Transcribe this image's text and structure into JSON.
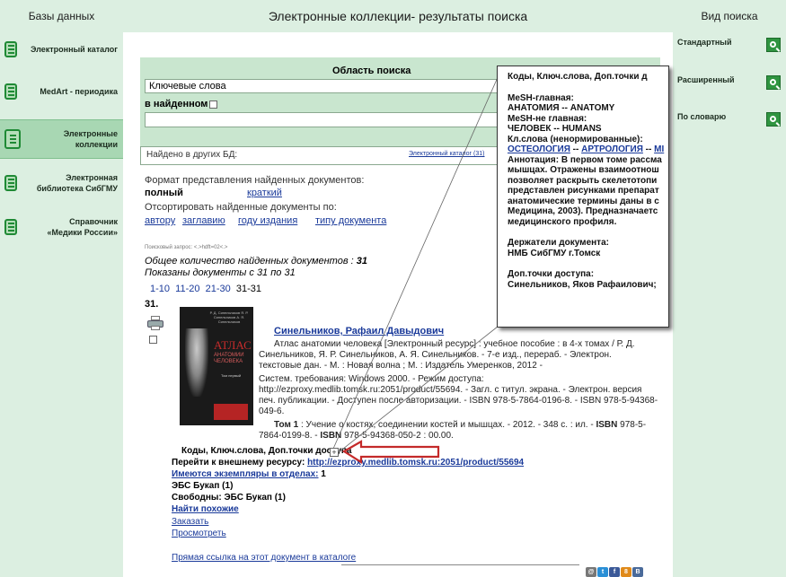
{
  "left": {
    "title": "Базы данных",
    "items": [
      {
        "label": "Электронный каталог"
      },
      {
        "label": "MedArt - периодика"
      },
      {
        "label": "Электронные коллекции"
      },
      {
        "label": "Электронная библиотека СибГМУ"
      },
      {
        "label": "Справочник «Медики России»"
      }
    ]
  },
  "header": {
    "title": "Электронные коллекции- результаты поиска"
  },
  "right": {
    "title": "Вид поиска",
    "modes": [
      {
        "label": "Стандартный"
      },
      {
        "label": "Расширенный"
      },
      {
        "label": "По словарю"
      }
    ]
  },
  "search": {
    "area_label": "Область поиска",
    "field_select": "Ключевые слова",
    "in_found_label": "в найденном",
    "query": ""
  },
  "found_other": {
    "label": "Найдено в других БД:",
    "link": "Электронный каталог (31)"
  },
  "format": {
    "label": "Формат представления найденных документов:",
    "full": "полный",
    "short": "краткий"
  },
  "sort": {
    "label": "Отсортировать найденные документы по:",
    "by_author": "автору",
    "by_title": "заглавию",
    "by_year": "году издания",
    "by_type": "типу документа"
  },
  "query_info": "Поисковый запрос: <.>hdft=02<.>",
  "results": {
    "total_label": "Общее количество найденных документов : ",
    "total": "31",
    "shown_label": "Показаны документы с 31 по 31",
    "pages": [
      "1-10",
      "11-20",
      "21-30"
    ],
    "current_page": "31-31"
  },
  "record": {
    "number": "31.",
    "author": "Синельников, Рафаил Давыдович",
    "lines": [
      "Атлас анатомии человека [Электронный ресурс] : учебное пособие : в 4-х томах / Р. Д.",
      "Синельников, Я. Р. Синельников, А. Я. Синельников. - 7-е изд., перераб. - Электрон.",
      "текстовые дан. - М. : Новая волна ; М. : Издатель Умеренков, 2012 -",
      "Систем. требования: Windows 2000. - Режим доступа:",
      "http://ezproxy.medlib.tomsk.ru:2051/product/55694. - Загл. с титул. экрана. - Электрон. версия",
      "печ. публикации. - Доступен после авторизации. - ISBN 978-5-7864-0196-8. - ISBN 978-5-94368-",
      "049-6."
    ],
    "vol_label": "Том 1",
    "vol_line1": " : Учение о костях, соединении костей и мышцах. - 2012. - 348 с. : ил. - ",
    "isbn_label": "ISBN",
    "vol_isbn": " 978-5-",
    "vol_line2": "7864-0199-8. - ",
    "vol_line2b": " 978-5-94368-050-2 : 00.00.",
    "codes_label": "Коды, Ключ.слова, Доп.точки доступа",
    "goto_label": "Перейти к внешнему ресурсу: ",
    "goto_url": "http://ezproxy.medlib.tomsk.ru:2051/product/55694",
    "copies_link": "Имеются экземпляры в отделах:",
    "copies_count": " 1",
    "ebs_line": "ЭБС Букап (1)",
    "free_line": "Свободны: ЭБС Букап (1)",
    "similar": "Найти похожие",
    "order": "Заказать",
    "view": "Просмотреть",
    "direct_link": "Прямая ссылка на этот документ в каталоге",
    "cover": {
      "authors": "Р. Д. Синельников Я. Р. Синельников А. Я. Синельников",
      "title": "АТЛАС",
      "subtitle": "АНАТОМИИ ЧЕЛОВЕКА",
      "volume": "Том первый"
    }
  },
  "popup": {
    "header": "Коды, Ключ.слова, Доп.точки д",
    "mesh_main_label": "MeSH-главная:",
    "mesh_main": "АНАТОМИЯ -- ANATOMY",
    "mesh_other_label": "MeSH-не главная:",
    "mesh_other": "ЧЕЛОВЕК -- HUMANS",
    "kw_label": "Кл.слова (ненормированные):",
    "kw1": "ОСТЕОЛОГИЯ",
    "kw_sep": " -- ",
    "kw2": "АРТРОЛОГИЯ",
    "kw3": "МІ",
    "annotation": [
      "Аннотация: В первом томе рассма",
      "мышцах. Отражены взаимоотнош",
      "позволяет раскрыть скелетотопи",
      "представлен рисунками препарат",
      "анатомические термины даны в с",
      "Медицина, 2003). Предназначаетс",
      "медицинского профиля."
    ],
    "holders_label": "Держатели документа:",
    "holders": "НМБ СибГМУ г.Томск",
    "access_label": "Доп.точки доступа:",
    "access": "Синельников, Яков Рафаилович;"
  },
  "social": [
    "@",
    "t",
    "f",
    "8",
    "В"
  ],
  "colors": {
    "sidebar_bg": "#dcefe1",
    "panel_bg": "#c9e6cf",
    "active_item_bg": "#a8d7b3",
    "link": "#1a3a9a",
    "arrow": "#c42a2a",
    "icon_green": "#2f9440"
  }
}
